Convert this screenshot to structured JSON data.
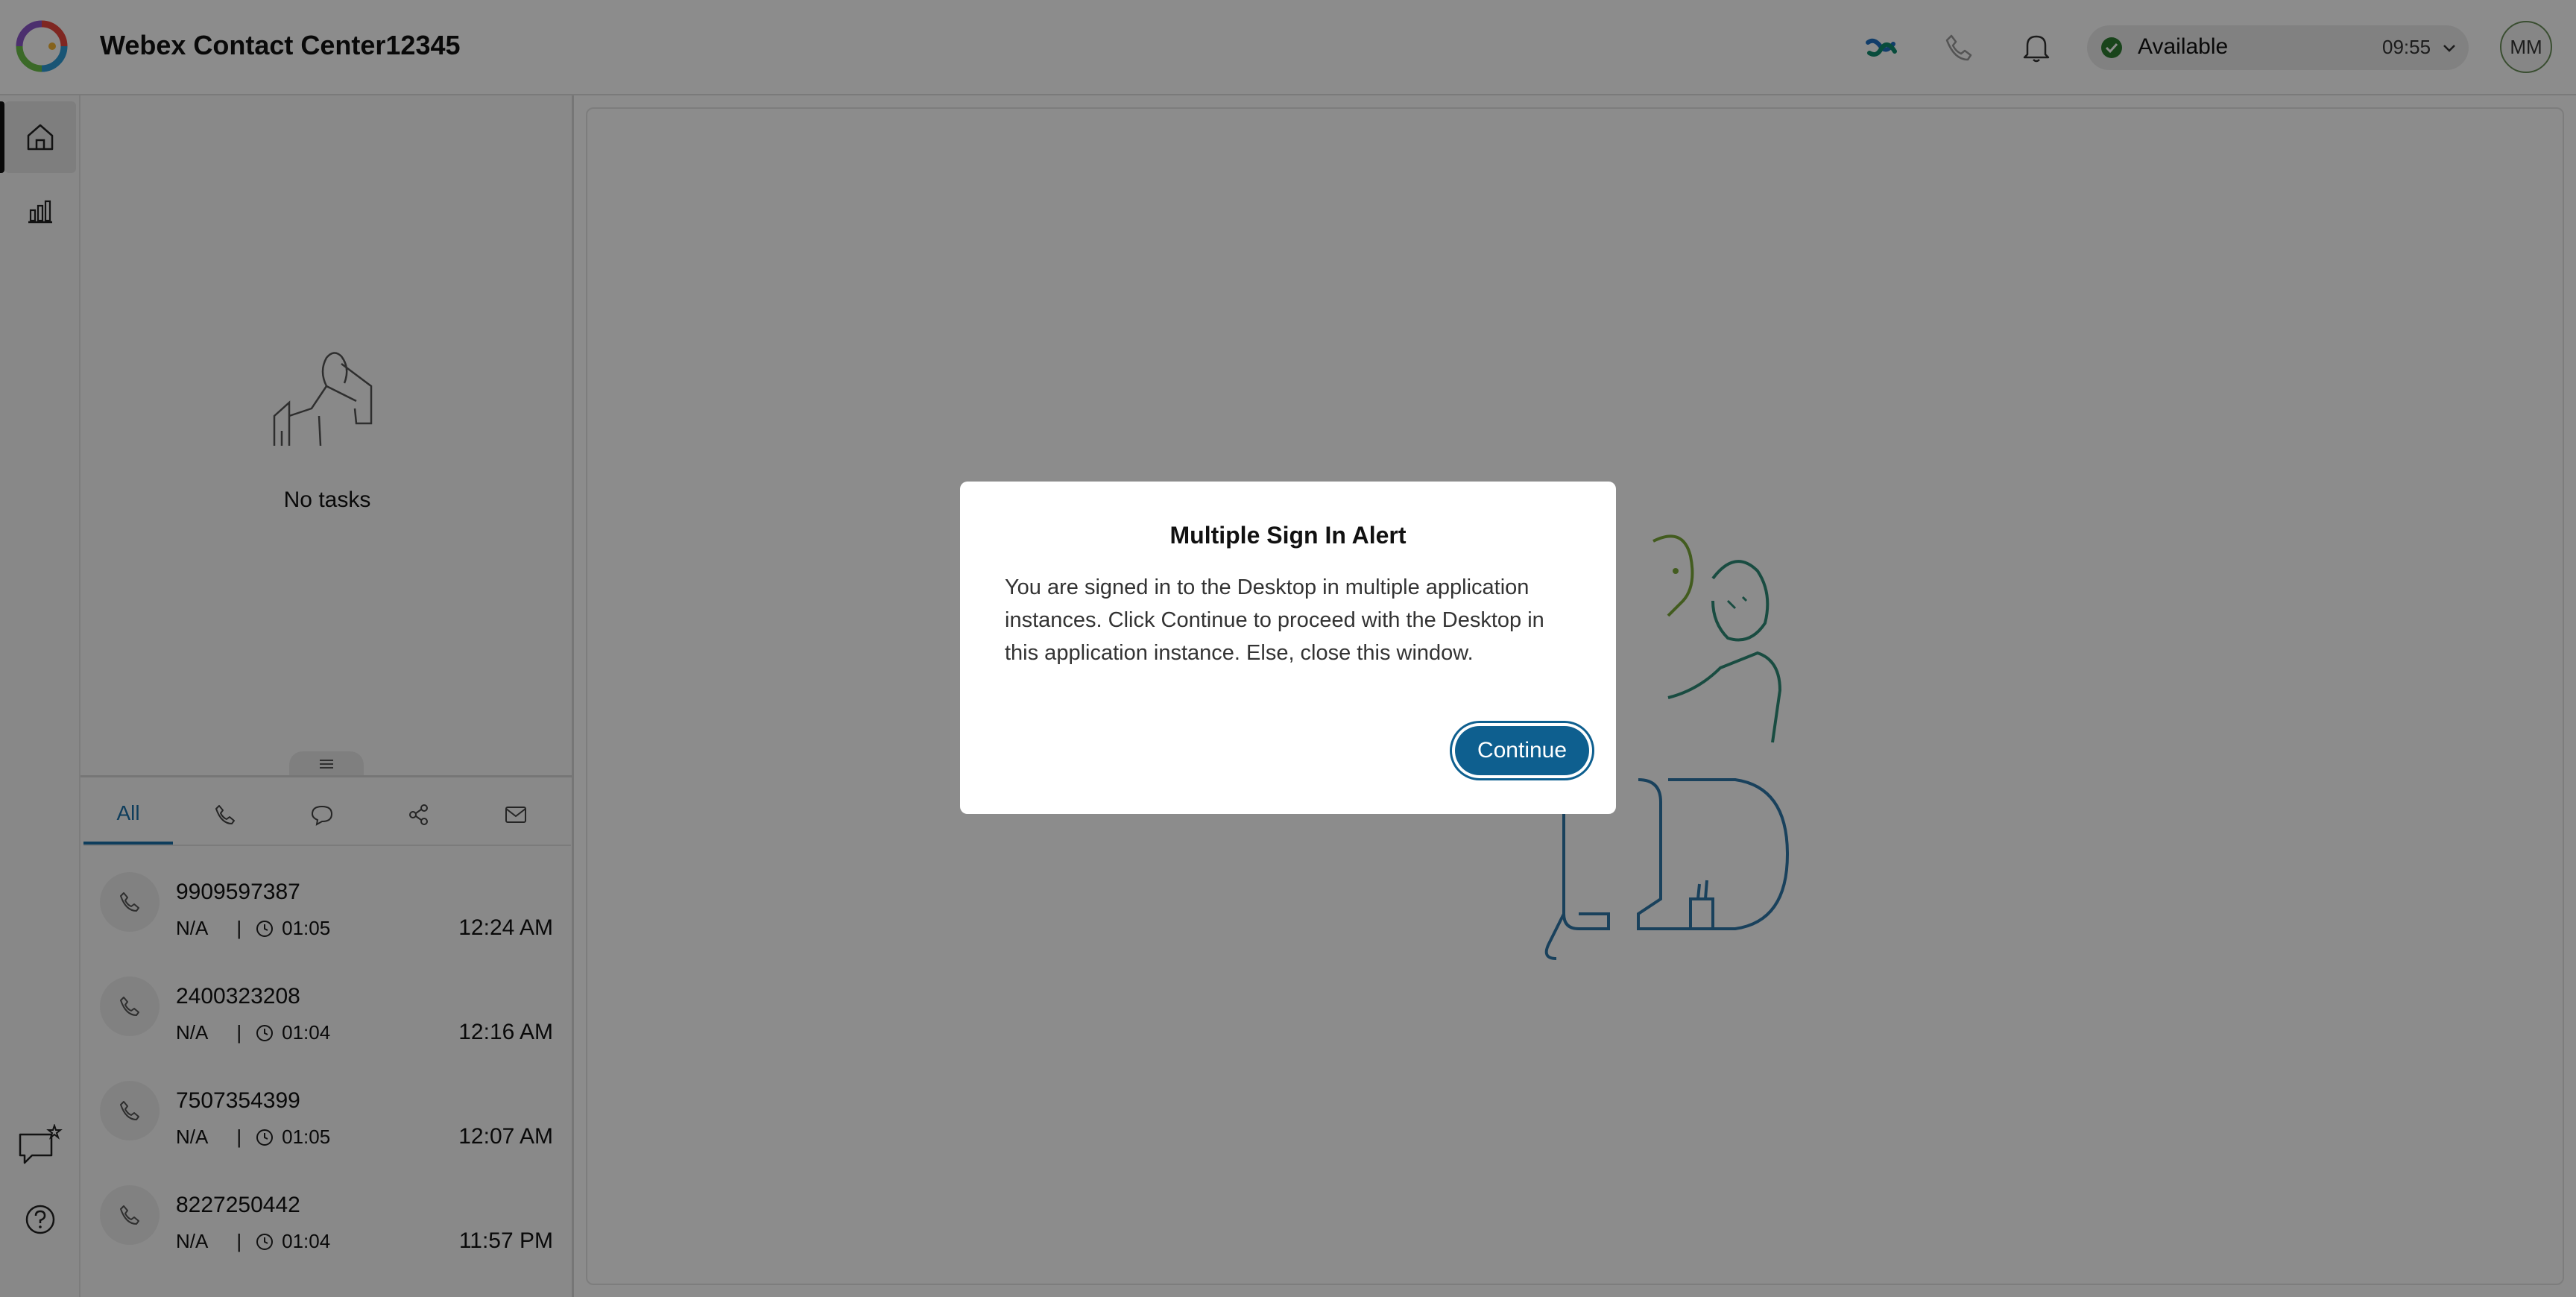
{
  "header": {
    "app_title": "Webex Contact Center12345",
    "status": {
      "label": "Available",
      "timer": "09:55",
      "color": "#2e7d32"
    },
    "avatar_initials": "MM",
    "icons": [
      "webex-logo-icon",
      "phone-icon",
      "bell-icon",
      "chevron-down-icon"
    ]
  },
  "rail": {
    "items": [
      {
        "name": "home-icon",
        "active": true
      },
      {
        "name": "bar-chart-icon",
        "active": false
      }
    ],
    "bottom_items": [
      "chat-star-icon",
      "help-icon"
    ]
  },
  "task_panel": {
    "empty_text": "No tasks",
    "tabs": [
      {
        "label": "All",
        "active": true
      },
      {
        "icon": "phone-icon"
      },
      {
        "icon": "chat-icon"
      },
      {
        "icon": "share-icon"
      },
      {
        "icon": "mail-icon"
      }
    ],
    "tasks": [
      {
        "number": "9909597387",
        "queue": "N/A",
        "duration": "01:05",
        "time": "12:24 AM"
      },
      {
        "number": "2400323208",
        "queue": "N/A",
        "duration": "01:04",
        "time": "12:16 AM"
      },
      {
        "number": "7507354399",
        "queue": "N/A",
        "duration": "01:05",
        "time": "12:07 AM"
      },
      {
        "number": "8227250442",
        "queue": "N/A",
        "duration": "01:04",
        "time": "11:57 PM"
      }
    ]
  },
  "modal": {
    "title": "Multiple Sign In Alert",
    "body": "You are signed in to the Desktop in multiple application instances. Click Continue to proceed with the Desktop in this application instance. Else, close this window.",
    "continue_label": "Continue"
  },
  "colors": {
    "accent": "#0e5f8f",
    "tab_active": "#1a6fa8",
    "overlay": "rgba(0,0,0,0.45)"
  }
}
